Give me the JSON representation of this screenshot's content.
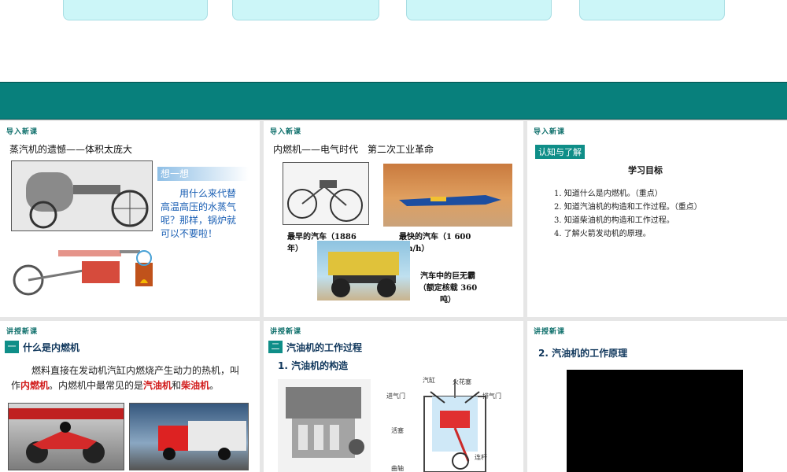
{
  "slides": {
    "s1": {
      "tag": "导入新课",
      "title": "蒸汽机的遗憾——体积太庞大",
      "think_heading": "想一想",
      "think_body": "用什么来代替高温高压的水蒸气呢？那样，锅炉就可以不要啦！"
    },
    "s2": {
      "tag": "导入新课",
      "title": "内燃机——电气时代　第二次工业革命",
      "cap_earliest": "最早的汽车（1886年）",
      "cap_fastest": "最快的汽车（1 600 km/h）",
      "cap_giant": "汽车中的巨无霸（额定核载 360 吨）"
    },
    "s3": {
      "tag": "导入新课",
      "badge": "认知与了解",
      "goals_title": "学习目标",
      "goals": [
        "1. 知道什么是内燃机。（重点）",
        "2. 知道汽油机的构造和工作过程。（重点）",
        "3. 知道柴油机的构造和工作过程。",
        "4. 了解火箭发动机的原理。"
      ]
    },
    "s4": {
      "tag": "讲授新课",
      "sec_num": "一",
      "sec_title": "什么是内燃机",
      "p1": "燃料直接在发动机汽缸内燃烧产生动力的热机，叫作",
      "r1": "内燃机",
      "p2": "。内燃机中最常见的是",
      "r2": "汽油机",
      "p3": "和",
      "r3": "柴油机",
      "p4": "。"
    },
    "s5": {
      "tag": "讲授新课",
      "sec_num": "二",
      "sec_title": "汽油机的工作过程",
      "sub": "1. 汽油机的构造",
      "labels": {
        "cylinder": "汽缸",
        "spark_plug": "火花塞",
        "intake": "进气门",
        "exhaust": "排气门",
        "piston": "活塞",
        "rod": "连杆",
        "crank": "曲轴"
      }
    },
    "s6": {
      "tag": "讲授新课",
      "sub": "2. 汽油机的工作原理"
    }
  },
  "colors": {
    "teal": "#08807c",
    "card": "#ccf6f8",
    "red": "#d11a1a"
  }
}
